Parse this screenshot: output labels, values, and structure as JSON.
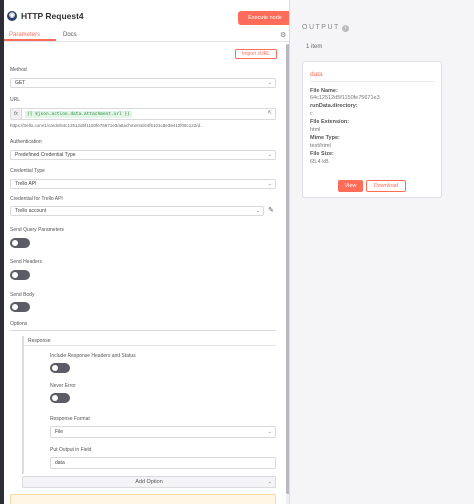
{
  "node": {
    "icon": "globe-icon",
    "title": "HTTP Request4",
    "execute_label": "Execute node"
  },
  "tabs": {
    "parameters": "Parameters",
    "docs": "Docs"
  },
  "settings_icon": "gear-icon",
  "import_curl_label": "Import cURL",
  "method": {
    "label": "Method",
    "value": "GET"
  },
  "url": {
    "label": "URL",
    "fx": "fx",
    "expression": "{{ $json.action.data.attachment.url }}",
    "preview": "https://trello.com/1/cards/64c12512d5f1150fe75671e3/attachments/64f5101c8e39412f05c122/d..."
  },
  "authentication": {
    "label": "Authentication",
    "value": "Predefined Credential Type"
  },
  "credential_type": {
    "label": "Credential Type",
    "value": "Trello API"
  },
  "credential": {
    "label": "Credential for Trello API",
    "value": "Trello account"
  },
  "toggles": {
    "query_label": "Send Query Parameters",
    "headers_label": "Send Headers",
    "body_label": "Send Body"
  },
  "options": {
    "label": "Options",
    "response": {
      "label": "Response",
      "include_headers_label": "Include Response Headers and Status",
      "never_error_label": "Never Error",
      "format_label": "Response Format",
      "format_value": "File",
      "output_field_label": "Put Output in Field",
      "output_field_value": "data"
    },
    "add_option_label": "Add Option"
  },
  "output": {
    "title": "OUTPUT",
    "count": "1 item",
    "binary": {
      "key": "data",
      "file_name_label": "File Name:",
      "file_name_value": "64c12512d5f1150fe75671e3",
      "directory_label": "runData.directory:",
      "directory_value": "c",
      "extension_label": "File Extension:",
      "extension_value": "html",
      "mime_label": "Mime Type:",
      "mime_value": "text/html",
      "size_label": "File Size:",
      "size_value": "65.4 kB",
      "view_label": "View",
      "download_label": "Download"
    }
  },
  "colors": {
    "accent": "#ff6d5a",
    "expression_bg": "#e2f5e6",
    "expression_text": "#2a8a3e"
  }
}
